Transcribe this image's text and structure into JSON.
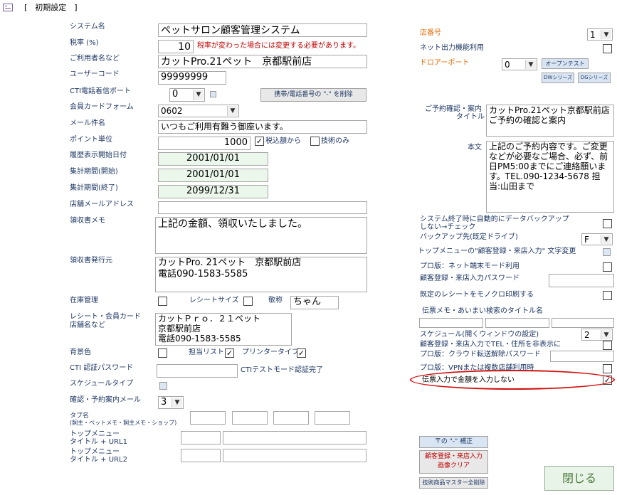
{
  "title_bar": {
    "title": "[　初期設定　]"
  },
  "left": {
    "system_name": {
      "label": "システム名",
      "value": "ペットサロン顧客管理システム"
    },
    "tax_rate": {
      "label": "税率 (%)",
      "value": "10",
      "note": "税率が変わった場合には変更する必要があります。"
    },
    "user_name": {
      "label": "ご利用者名など",
      "value": "カットPro.21ペット　京都駅前店"
    },
    "user_code": {
      "label": "ユーザーコード",
      "value": "99999999"
    },
    "cti_port": {
      "label": "CTI電話着信ポート",
      "value": "0",
      "remove_hyphen_button": "携帯/電話番号の \"-\" を削除"
    },
    "member_card_form": {
      "label": "会員カードフォーム",
      "value": "0602"
    },
    "mail_subject": {
      "label": "メール件名",
      "value": "いつもご利用有難う御座います。"
    },
    "point_unit": {
      "label": "ポイント単位",
      "value": "1000",
      "tax_included_label": "税込額から",
      "tax_included_checked": "✓",
      "tech_only_label": "技術のみ"
    },
    "history_start": {
      "label": "履歴表示開始日付",
      "value": "2001/01/01"
    },
    "period_start": {
      "label": "集計期間(開始)",
      "value": "2001/01/01"
    },
    "period_end": {
      "label": "集計期間(終了)",
      "value": "2099/12/31"
    },
    "shop_mail": {
      "label": "店舗メールアドレス",
      "value": ""
    },
    "receipt_memo": {
      "label": "領収書メモ",
      "value": "上記の金額、領収いたしました。"
    },
    "receipt_issuer": {
      "label": "領収書発行元",
      "value": "カットPro. 21ペット　京都駅前店\n電話090-1583-5585"
    },
    "stock_mgmt": {
      "label": "在庫管理",
      "receipt_size_label": "レシートサイズ",
      "honorific_label": "敬称",
      "honorific_value": "ちゃん"
    },
    "receipt_shop": {
      "label1": "レシート・会員カード",
      "label2": "店舗名など",
      "value": "カットＰｒｏ．２１ペット\n京都駅前店\n電話090-1583-5585"
    },
    "bg_color": {
      "label": "背景色",
      "staff_list_label": "担当リスト",
      "staff_list_checked": "✓",
      "printer_type_label": "プリンタータイプ",
      "printer_type_checked": "✓"
    },
    "cti_password": {
      "label": "CTI 認証パスワード",
      "test_mode_label": "CTIテストモード認証完了"
    },
    "schedule_type": {
      "label": "スケジュールタイプ"
    },
    "confirm_mail": {
      "label": "確認・予約案内メール",
      "value": "3"
    },
    "tab_names": {
      "label1": "タブ名",
      "label2": "(飼主・ペットメモ・飼主メモ・ショップ)"
    },
    "top_menu1": {
      "label1": "トップメニュー",
      "label2": "タイトル + URL1"
    },
    "top_menu2": {
      "label1": "トップメニュー",
      "label2": "タイトル + URL2"
    }
  },
  "right": {
    "shop_number": {
      "label": "店番号",
      "value": "1"
    },
    "net_output": {
      "label": "ネット出力機能利用"
    },
    "drawer_port": {
      "label": "ドロアーポート",
      "value": "0",
      "open_test_button": "オープンテスト",
      "dw_button": "DWシリーズ",
      "dg_button": "DGシリーズ"
    },
    "reservation_title": {
      "label1": "ご予約確認・案内",
      "label2": "タイトル",
      "value": "カットPro.21ペット京都駅前店\nご予約の確認と案内"
    },
    "body_text": {
      "label": "本文",
      "value": "上記のご予約内容です。ご変更などが必要なご場合、必ず、前日PM5:00までにご連絡願います。TEL.090-1234-5678 担当:山田まで"
    },
    "auto_backup": {
      "label1": "システム終了時に自動的にデータバックアップ",
      "label2": "しない→チェック"
    },
    "backup_drive": {
      "label": "バックアップ先(既定ドライブ)",
      "value": "F"
    },
    "top_menu_text": {
      "label": "トップメニューの\"顧客登録・来店入力\" 文字変更"
    },
    "pro_net": {
      "label": "プロ版：ネット端末モード利用"
    },
    "reg_password": {
      "label": "顧客登録・来店入力パスワード"
    },
    "mono_receipt": {
      "label": "既定のレシートをモノクロ印刷する"
    },
    "memo_search_title": {
      "label": "伝票メモ・あいまい検索のタイトル名"
    },
    "schedule": {
      "label": "スケジュール(開くウィンドウの設定)",
      "value": "2"
    },
    "hide_tel": {
      "label": "顧客登録・来店入力でTEL・住所を非表示に"
    },
    "cloud_password": {
      "label": "プロ版：クラウド転送解除パスワード"
    },
    "vpn": {
      "label": "プロ版：VPNまたは複数店舗利用時"
    },
    "no_amount": {
      "label": "伝票入力で金額を入力しない",
      "checked": "✓"
    },
    "hyphen_fix_button": "〒の \"-\" 補正",
    "clear_image_button": "顧客登録・来店入力\n画像クリア",
    "delete_tech_button": "技術商品マスター全削除",
    "close_button": "閉じる"
  }
}
